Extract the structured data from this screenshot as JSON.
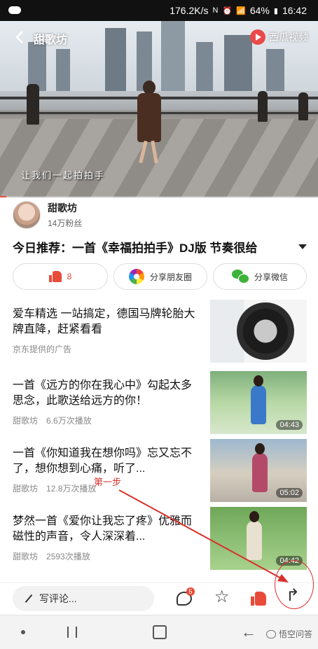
{
  "status_bar": {
    "network_speed": "176.2K/s",
    "battery": "64%",
    "time": "16:42"
  },
  "video": {
    "channel_name": "甜歌坊",
    "platform_label": "西瓜视频",
    "subtitle": "让我们一起拍拍手",
    "progress": 0.02
  },
  "author": {
    "name": "甜歌坊",
    "fans": "14万粉丝"
  },
  "title": "今日推荐：一首《幸福拍拍手》DJ版 节奏很给",
  "actions": {
    "like_count": "8",
    "share_moments": "分享朋友圈",
    "share_wechat": "分享微信"
  },
  "feed": [
    {
      "title": "爱车精选 一站搞定，德国马牌轮胎大牌直降，赶紧看看",
      "source": "京东提供的广告",
      "plays": "",
      "duration": ""
    },
    {
      "title": "一首《远方的你在我心中》勾起太多思念，此歌送给远方的你！",
      "source": "甜歌坊",
      "plays": "6.6万次播放",
      "duration": "04:43"
    },
    {
      "title": "一首《你知道我在想你吗》忘又忘不了，想你想到心痛，听了...",
      "source": "甜歌坊",
      "plays": "12.8万次播放",
      "duration": "05:02"
    },
    {
      "title": "梦然一首《爱你让我忘了疼》优雅而磁性的声音，令人深深着...",
      "source": "甜歌坊",
      "plays": "2593次播放",
      "duration": "04:42"
    }
  ],
  "comment_bar": {
    "placeholder": "写评论...",
    "comment_badge": "5"
  },
  "annotation": {
    "step_label": "第一步"
  },
  "watermark": "悟空问答"
}
